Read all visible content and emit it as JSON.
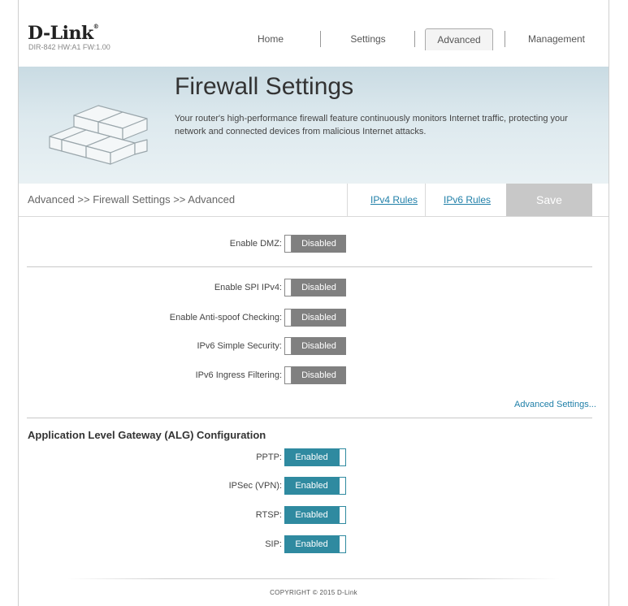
{
  "header": {
    "logo": "D-Link",
    "model": "DIR-842  HW:A1  FW:1.00",
    "nav": {
      "home": "Home",
      "settings": "Settings",
      "advanced": "Advanced",
      "management": "Management"
    }
  },
  "banner": {
    "title": "Firewall Settings",
    "description": "Your router's high-performance firewall feature continuously monitors Internet traffic, protecting your network and connected devices from malicious Internet attacks."
  },
  "breadcrumb": "Advanced >> Firewall Settings >> Advanced",
  "tabs": {
    "ipv4": "IPv4 Rules",
    "ipv6": "IPv6 Rules",
    "save": "Save"
  },
  "dmz": {
    "label": "Enable DMZ:",
    "state": "Disabled"
  },
  "security": [
    {
      "label": "Enable SPI IPv4:",
      "state": "Disabled"
    },
    {
      "label": "Enable Anti-spoof Checking:",
      "state": "Disabled"
    },
    {
      "label": "IPv6 Simple Security:",
      "state": "Disabled"
    },
    {
      "label": "IPv6 Ingress Filtering:",
      "state": "Disabled"
    }
  ],
  "advanced_settings_link": "Advanced Settings...",
  "alg": {
    "title": "Application Level Gateway (ALG) Configuration",
    "items": [
      {
        "label": "PPTP:",
        "state": "Enabled"
      },
      {
        "label": "IPSec (VPN):",
        "state": "Enabled"
      },
      {
        "label": "RTSP:",
        "state": "Enabled"
      },
      {
        "label": "SIP:",
        "state": "Enabled"
      }
    ]
  },
  "footer": {
    "copyright": "COPYRIGHT © 2015 D-Link"
  },
  "colors": {
    "enabled": "#2f8aa0",
    "disabled": "#808080",
    "link": "#1f7fa8",
    "save": "#c8c8c8"
  }
}
